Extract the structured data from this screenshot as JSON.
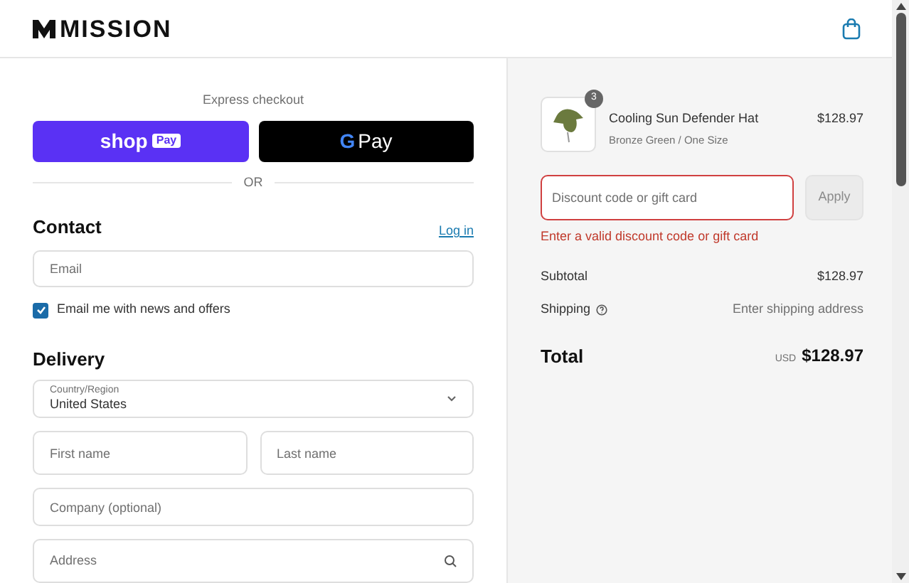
{
  "header": {
    "logo_text": "MISSION"
  },
  "express": {
    "title": "Express checkout",
    "shop_pay": {
      "word": "shop",
      "badge": "Pay"
    },
    "google_pay": {
      "letter": "G",
      "word": "Pay"
    },
    "divider": "OR"
  },
  "contact": {
    "title": "Contact",
    "login": "Log in",
    "email": {
      "placeholder": "Email"
    },
    "newsletter": {
      "label": "Email me with news and offers",
      "checked": true
    }
  },
  "delivery": {
    "title": "Delivery",
    "country": {
      "label": "Country/Region",
      "value": "United States"
    },
    "fields": [
      {
        "placeholder": "First name"
      },
      {
        "placeholder": "Last name"
      }
    ],
    "company": {
      "placeholder": "Company (optional)"
    },
    "address": {
      "placeholder": "Address"
    }
  },
  "order": {
    "item": {
      "quantity": "3",
      "name": "Cooling Sun Defender Hat",
      "variant": "Bronze Green / One Size",
      "price": "$128.97"
    },
    "discount": {
      "placeholder": "Discount code or gift card",
      "button": "Apply",
      "error": "Enter a valid discount code or gift card"
    },
    "subtotal": {
      "label": "Subtotal",
      "value": "$128.97"
    },
    "shipping": {
      "label": "Shipping",
      "value": "Enter shipping address"
    },
    "total": {
      "label": "Total",
      "currency": "USD",
      "value": "$128.97"
    }
  }
}
